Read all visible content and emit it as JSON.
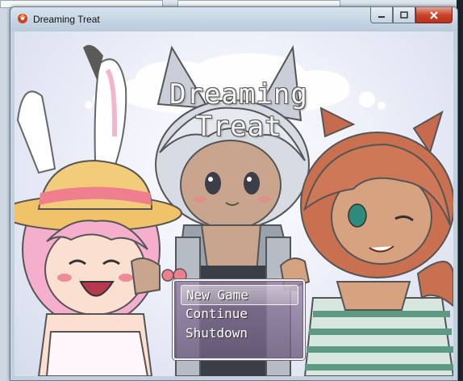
{
  "window": {
    "title": "Dreaming Treat",
    "controls": {
      "minimize_icon": "minimize-icon",
      "maximize_icon": "maximize-icon",
      "close_icon": "close-icon"
    }
  },
  "game": {
    "title": "Dreaming Treat",
    "menu": [
      {
        "label": "New Game",
        "selected": true
      },
      {
        "label": "Continue",
        "selected": false
      },
      {
        "label": "Shutdown",
        "selected": false
      }
    ]
  },
  "colors": {
    "close_button": "#c9452c",
    "menu_background": "#8a7a9a",
    "background": "#eef0fa"
  }
}
